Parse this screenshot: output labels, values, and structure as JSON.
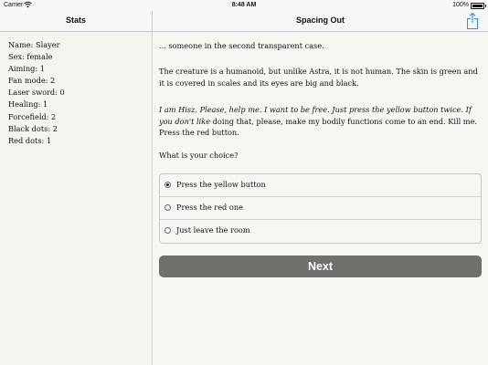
{
  "status_bar": {
    "carrier": "Carrier",
    "time": "8:48 AM",
    "battery": "100%",
    "battery_level": 1.0
  },
  "sidebar": {
    "title": "Stats",
    "stats": [
      "Name: Slayer",
      "Sex: female",
      "Aiming: 1",
      "Fan mode: 2",
      "Laser sword: 0",
      "Healing: 1",
      "Forcefield: 2",
      "Black dots: 2",
      "Red dots: 1"
    ]
  },
  "main": {
    "title": "Spacing Out",
    "share_icon": "share-icon",
    "paragraphs": [
      "... someone in the second transparent case.",
      "The creature is a humanoid, but unlike Astra, it is not human. The skin is green and it is covered in scales and its eyes are big and black.",
      "What is your choice?"
    ],
    "quote": {
      "italic": "I am Hisz. Please, help me. I want to be free. Just press the yellow button twice. If you don't like",
      "rest": " doing that, please, make my bodily functions come to an end. Kill me. Press the red button."
    },
    "choices": [
      {
        "label": "Press the yellow button",
        "selected": true
      },
      {
        "label": "Press the red one",
        "selected": false
      },
      {
        "label": "Just leave the room",
        "selected": false
      }
    ],
    "next_label": "Next",
    "accent_color": "#6f6f6b"
  }
}
